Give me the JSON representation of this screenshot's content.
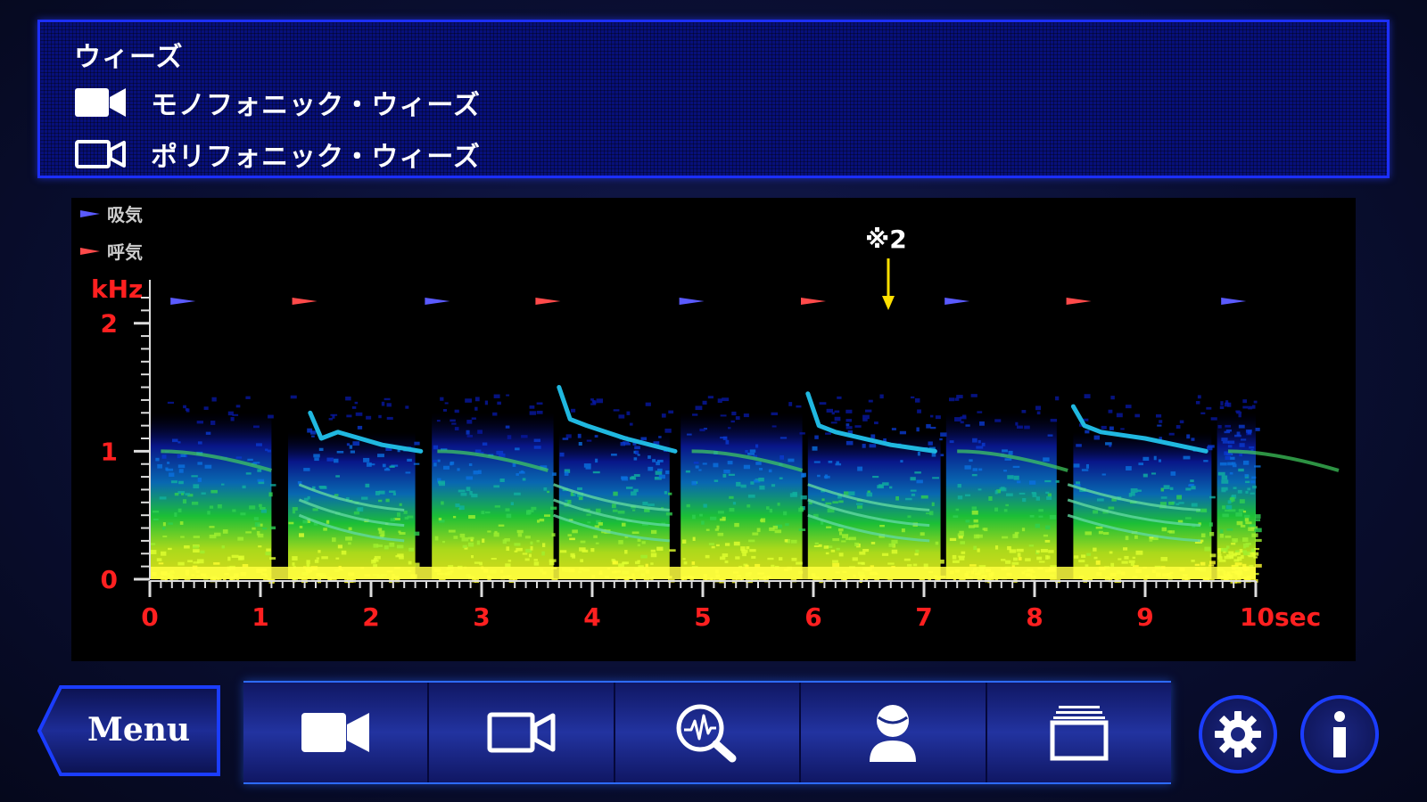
{
  "info": {
    "title": "ウィーズ",
    "legend": [
      {
        "icon": "video-camera-filled-icon",
        "label": "モノフォニック・ウィーズ"
      },
      {
        "icon": "video-camera-outline-icon",
        "label": "ポリフォニック・ウィーズ"
      }
    ]
  },
  "spectrogram": {
    "legend_inspiration": "吸気",
    "legend_expiration": "呼気",
    "y_unit": "kHz",
    "annotation": "※2",
    "colors": {
      "inspiration": "#5a5aff",
      "expiration": "#ff4a4a",
      "axis_label": "#ff2020",
      "annotation": "#ffe000"
    }
  },
  "chart_data": {
    "type": "heatmap",
    "title": "",
    "xlabel": "sec",
    "ylabel": "kHz",
    "xlim": [
      0,
      10
    ],
    "ylim": [
      0,
      2.2
    ],
    "x_ticks": [
      "0",
      "1",
      "2",
      "3",
      "4",
      "5",
      "6",
      "7",
      "8",
      "9",
      "10sec"
    ],
    "y_ticks": [
      "0",
      "1",
      "2"
    ],
    "inspiration_markers_sec": [
      0.3,
      2.6,
      4.9,
      7.3,
      9.8
    ],
    "expiration_markers_sec": [
      1.4,
      3.6,
      6.0,
      8.4
    ],
    "annotation_sec": 6.7
  },
  "toolbar": {
    "menu_label": "Menu",
    "tools": [
      {
        "icon": "video-camera-filled-icon"
      },
      {
        "icon": "video-camera-outline-icon"
      },
      {
        "icon": "waveform-search-icon"
      },
      {
        "icon": "person-icon"
      },
      {
        "icon": "stacked-cards-icon"
      }
    ],
    "settings_icon": "gear-icon",
    "info_icon": "info-icon"
  }
}
